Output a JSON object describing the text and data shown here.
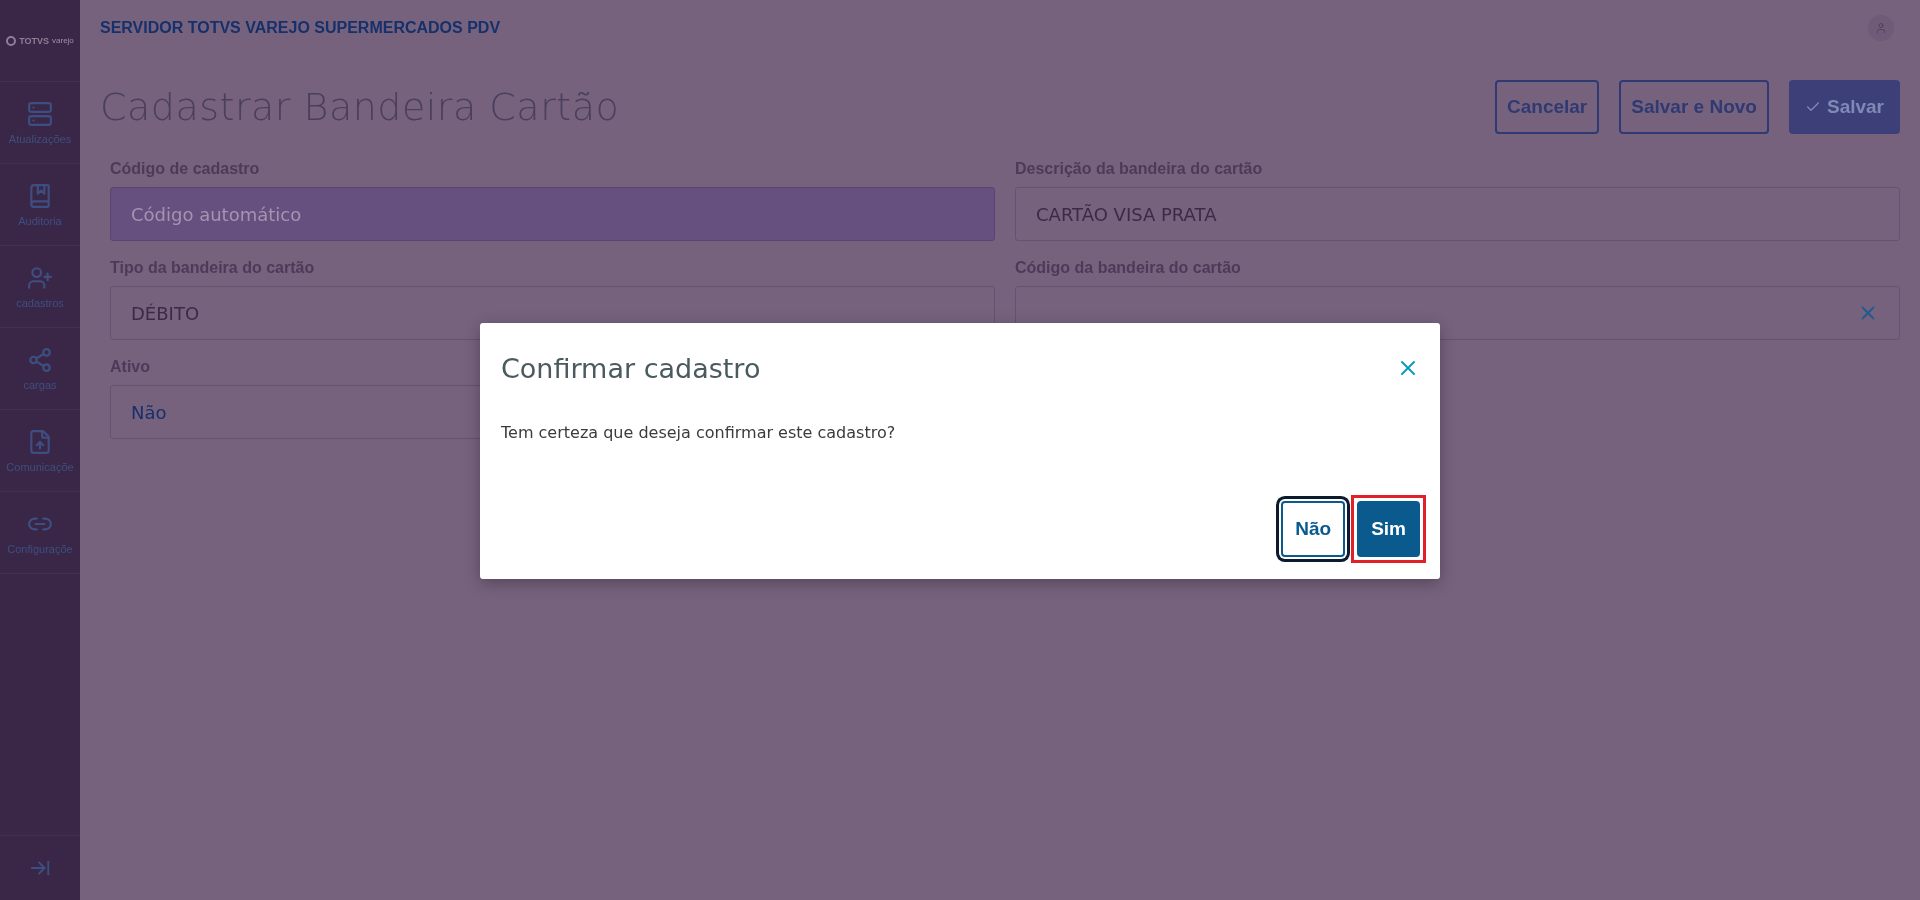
{
  "sidebar": {
    "logo": {
      "brand": "TOTVS",
      "sub": "varejo"
    },
    "items": [
      {
        "kind": "server",
        "label": "Atualizações"
      },
      {
        "kind": "book",
        "label": "Auditoria"
      },
      {
        "kind": "user-plus",
        "label": "cadastros"
      },
      {
        "kind": "share",
        "label": "cargas"
      },
      {
        "kind": "file-up",
        "label": "Comunicaçõe"
      },
      {
        "kind": "link",
        "label": "Configuraçõe"
      }
    ]
  },
  "header": {
    "title": "SERVIDOR TOTVS VAREJO SUPERMERCADOS PDV"
  },
  "page": {
    "title": "Cadastrar Bandeira Cartão",
    "actions": [
      {
        "label": "Cancelar",
        "primary": false
      },
      {
        "label": "Salvar e Novo",
        "primary": false
      },
      {
        "label": "Salvar",
        "primary": true
      }
    ]
  },
  "fields": [
    {
      "label": "Código de cadastro",
      "placeholder": "Código automático",
      "disabled": true
    },
    {
      "label": "Descrição da bandeira do cartão",
      "value": "CARTÃO VISA PRATA",
      "disabled": false
    },
    {
      "label": "Tipo da bandeira do cartão",
      "value": "DÉBITO",
      "disabled": false
    },
    {
      "label": "Código da bandeira do cartão",
      "disabled": false,
      "clearable": true
    },
    {
      "label": "Ativo",
      "value": "Não",
      "disabled": false,
      "link_style": true
    }
  ],
  "dialog": {
    "title": "Confirmar cadastro",
    "message": "Tem certeza que deseja confirmar este cadastro?",
    "buttons": [
      {
        "label": "Não",
        "primary": false,
        "focused": true,
        "highlighted": false
      },
      {
        "label": "Sim",
        "primary": true,
        "focused": false,
        "highlighted": true
      }
    ]
  }
}
